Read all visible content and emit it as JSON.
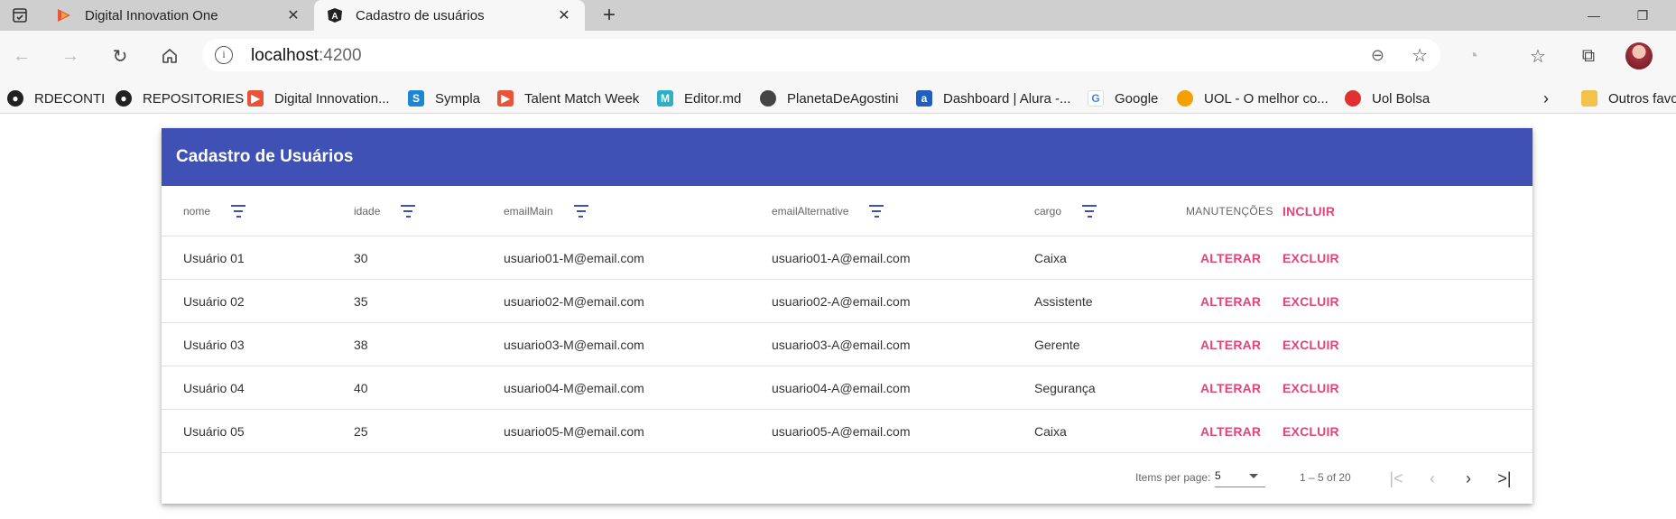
{
  "browser": {
    "tabs": [
      {
        "title": "Digital Innovation One",
        "favicon": "dio-icon",
        "active": false
      },
      {
        "title": "Cadastro de usuários",
        "favicon": "angular-icon",
        "active": true
      }
    ],
    "new_tab_symbol": "+",
    "window_buttons": {
      "minimize": "—",
      "restore": "❐"
    },
    "url_host": "localhost",
    "url_port": ":4200",
    "bookmarks": [
      {
        "label": "RDECONTI",
        "icon": "github-icon"
      },
      {
        "label": "REPOSITORIES",
        "icon": "github-icon"
      },
      {
        "label": "Digital Innovation...",
        "icon": "dio-icon"
      },
      {
        "label": "Sympla",
        "icon": "sympla-icon"
      },
      {
        "label": "Talent Match Week",
        "icon": "dio-icon"
      },
      {
        "label": "Editor.md",
        "icon": "editormd-icon"
      },
      {
        "label": "PlanetaDeAgostini",
        "icon": "planet-icon"
      },
      {
        "label": "Dashboard | Alura -...",
        "icon": "alura-icon"
      },
      {
        "label": "Google",
        "icon": "google-icon"
      },
      {
        "label": "UOL - O melhor co...",
        "icon": "uol-icon"
      },
      {
        "label": "Uol Bolsa",
        "icon": "uol-icon"
      },
      {
        "label": "Outros favo",
        "icon": "folder-icon"
      }
    ]
  },
  "page": {
    "title": "Cadastro de Usuários",
    "columns": [
      "nome",
      "idade",
      "emailMain",
      "emailAlternative",
      "cargo"
    ],
    "manutencoes_label": "MANUTENÇÕES",
    "incluir_label": "INCLUIR",
    "alterar_label": "ALTERAR",
    "excluir_label": "EXCLUIR",
    "rows": [
      {
        "nome": "Usuário 01",
        "idade": "30",
        "emailMain": "usuario01-M@email.com",
        "emailAlternative": "usuario01-A@email.com",
        "cargo": "Caixa"
      },
      {
        "nome": "Usuário 02",
        "idade": "35",
        "emailMain": "usuario02-M@email.com",
        "emailAlternative": "usuario02-A@email.com",
        "cargo": "Assistente"
      },
      {
        "nome": "Usuário 03",
        "idade": "38",
        "emailMain": "usuario03-M@email.com",
        "emailAlternative": "usuario03-A@email.com",
        "cargo": "Gerente"
      },
      {
        "nome": "Usuário 04",
        "idade": "40",
        "emailMain": "usuario04-M@email.com",
        "emailAlternative": "usuario04-A@email.com",
        "cargo": "Segurança"
      },
      {
        "nome": "Usuário 05",
        "idade": "25",
        "emailMain": "usuario05-M@email.com",
        "emailAlternative": "usuario05-A@email.com",
        "cargo": "Caixa"
      }
    ],
    "paginator": {
      "items_per_page_label": "Items per page:",
      "page_size": "5",
      "range_label": "1 – 5 of 20"
    }
  },
  "colors": {
    "primary": "#3f51b5",
    "accent": "#e0457b"
  }
}
